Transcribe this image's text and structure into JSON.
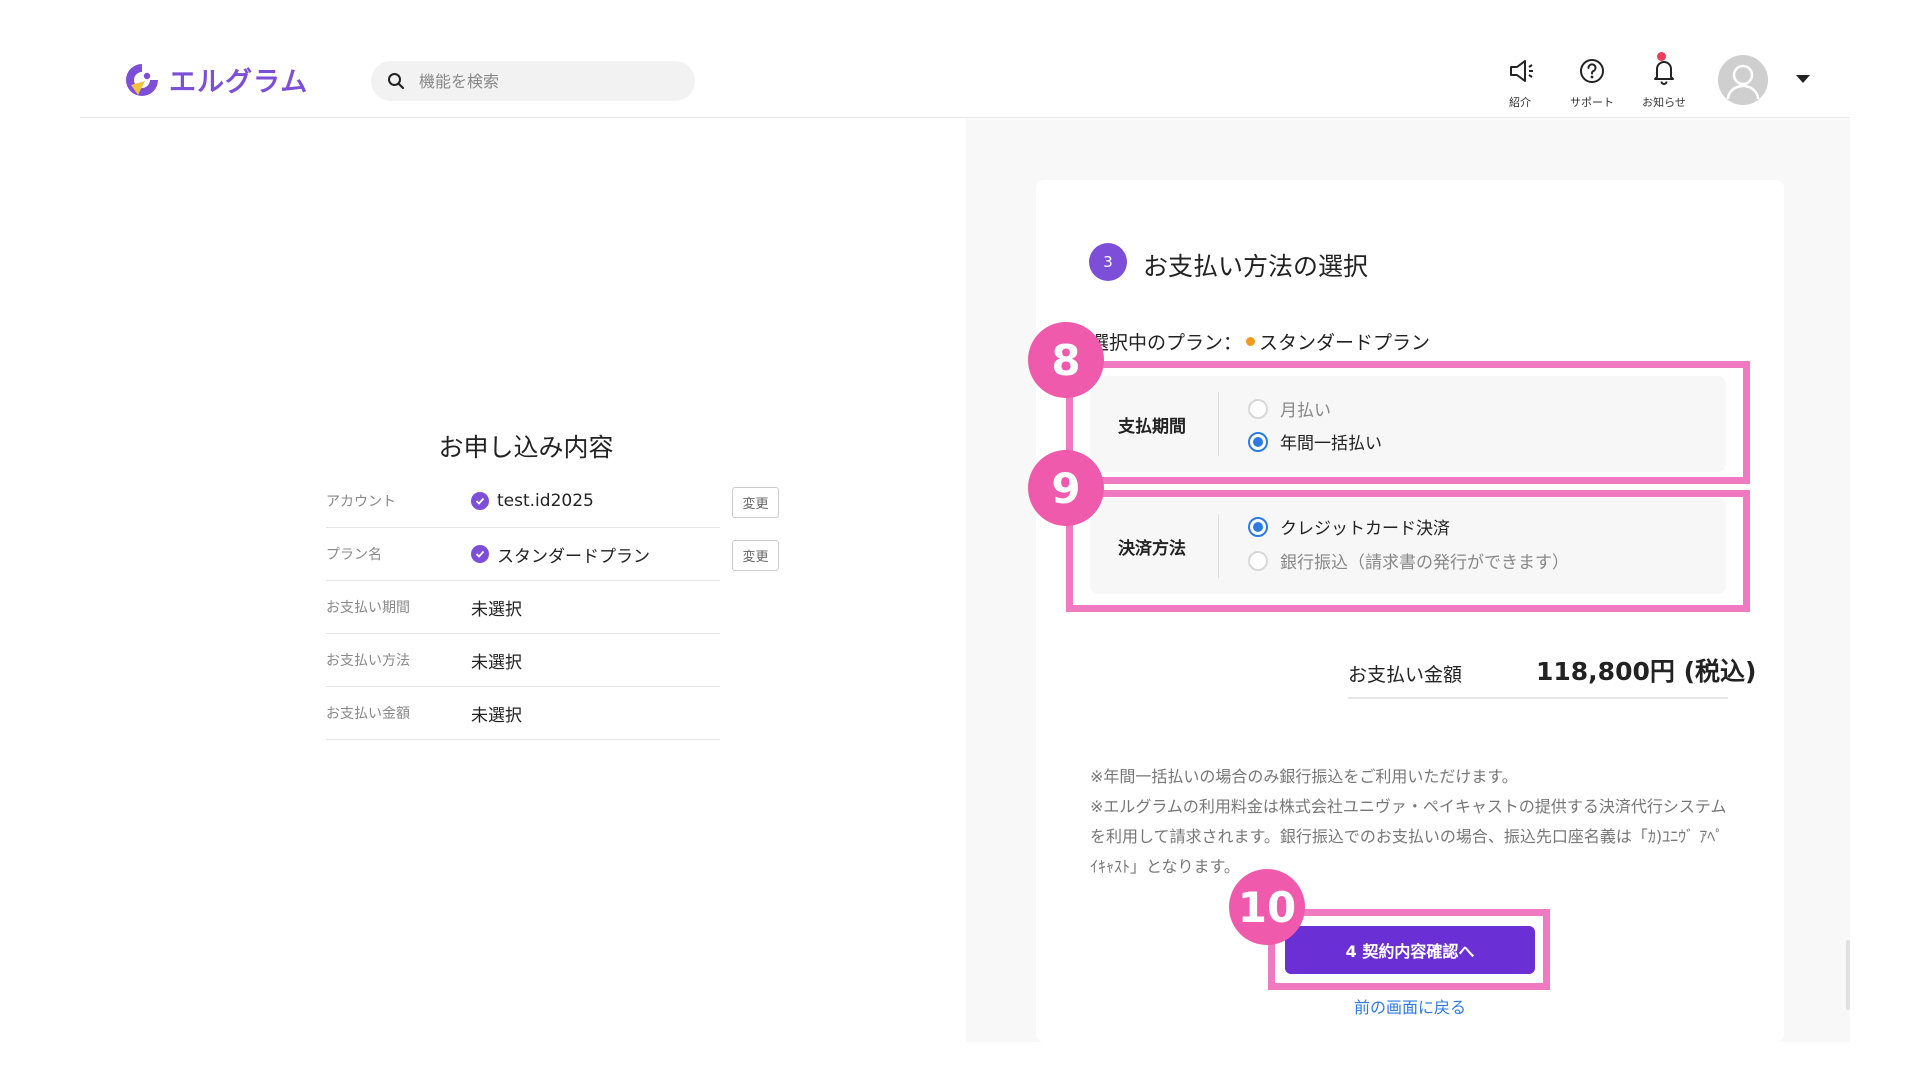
{
  "header": {
    "brand_name": "エルグラム",
    "search_placeholder": "機能を検索",
    "intro_label": "紹介",
    "support_label": "サポート",
    "notice_label": "お知らせ"
  },
  "summary": {
    "title": "お申し込み内容",
    "change_label": "変更",
    "rows": [
      {
        "label": "アカウント",
        "value": "test.id2025"
      },
      {
        "label": "プラン名",
        "value": "スタンダードプラン"
      },
      {
        "label": "お支払い期間",
        "value": "未選択"
      },
      {
        "label": "お支払い方法",
        "value": "未選択"
      },
      {
        "label": "お支払い金額",
        "value": "未選択"
      }
    ]
  },
  "payment": {
    "step_number": "3",
    "title": "お支払い方法の選択",
    "selected_plan_prefix": "選択中のプラン：",
    "selected_plan_name": "スタンダードプラン",
    "period": {
      "label": "支払期間",
      "options": [
        "月払い",
        "年間一括払い"
      ],
      "selected": "年間一括払い"
    },
    "method": {
      "label": "決済方法",
      "options": [
        "クレジットカード決済",
        "銀行振込（請求書の発行ができます）"
      ],
      "selected": "クレジットカード決済"
    },
    "amount_label": "お支払い金額",
    "amount_value": "118,800円 (税込)",
    "notes": [
      "※年間一括払いの場合のみ銀行振込をご利用いただけます。",
      "※エルグラムの利用料金は株式会社ユニヴァ・ペイキャストの提供する決済代行システムを利用して請求されます。銀行振込でのお支払いの場合、振込先口座名義は「ｶ)ﾕﾆｳﾞ ｱﾍﾟ ｲｷｬｽﾄ」となります。"
    ],
    "confirm_button": "4 契約内容確認へ",
    "back_link": "前の画面に戻る"
  },
  "annotations": [
    "8",
    "9",
    "10"
  ],
  "colors": {
    "brand_purple": "#7d4fd8",
    "button_purple": "#6b2fd6",
    "radio_blue": "#2c7be5",
    "highlight_pink": "#f07ac2",
    "badge_pink": "#f05aac",
    "plan_dot_orange": "#f39a1e",
    "notification_red": "#ee3d55"
  }
}
